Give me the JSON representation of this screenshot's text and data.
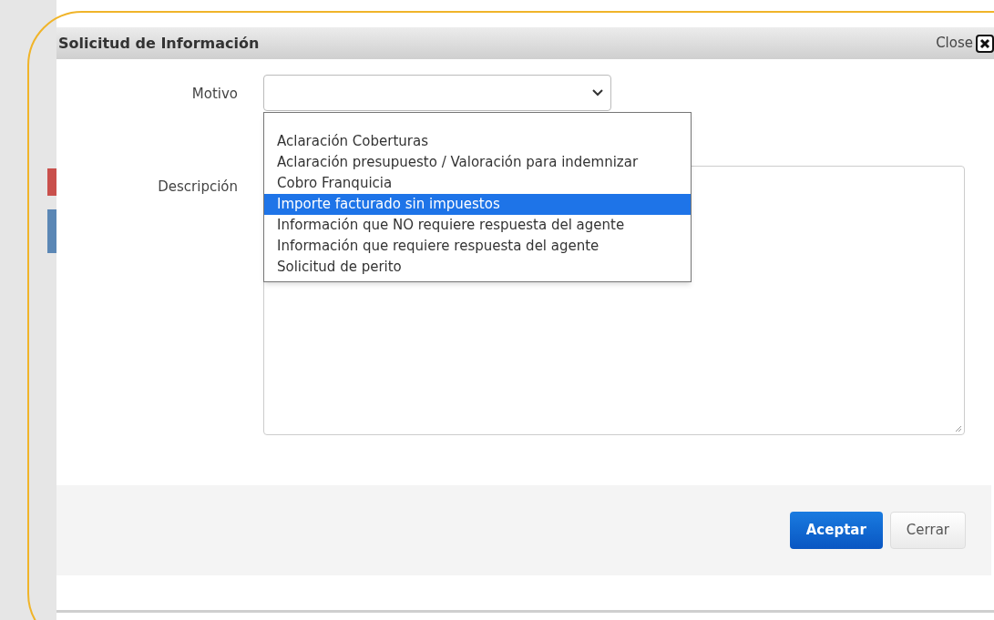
{
  "dialog": {
    "title": "Solicitud de Información",
    "close_label": "Close",
    "fields": [
      {
        "kind": "select",
        "label": "Motivo",
        "expanded": true
      },
      {
        "kind": "textarea",
        "label": "Descripción"
      }
    ],
    "options": [
      {
        "label": "Aclaración Coberturas",
        "selected": false
      },
      {
        "label": "Aclaración presupuesto / Valoración para indemnizar",
        "selected": false
      },
      {
        "label": "Cobro Franquicia",
        "selected": false
      },
      {
        "label": "Importe facturado sin impuestos",
        "selected": true
      },
      {
        "label": "Información que NO requiere respuesta del agente",
        "selected": false
      },
      {
        "label": "Información que requiere respuesta del agente",
        "selected": false
      },
      {
        "label": "Solicitud de perito",
        "selected": false
      }
    ],
    "buttons": [
      {
        "label": "Aceptar",
        "kind": "primary"
      },
      {
        "label": "Cerrar",
        "kind": "secondary"
      }
    ]
  }
}
